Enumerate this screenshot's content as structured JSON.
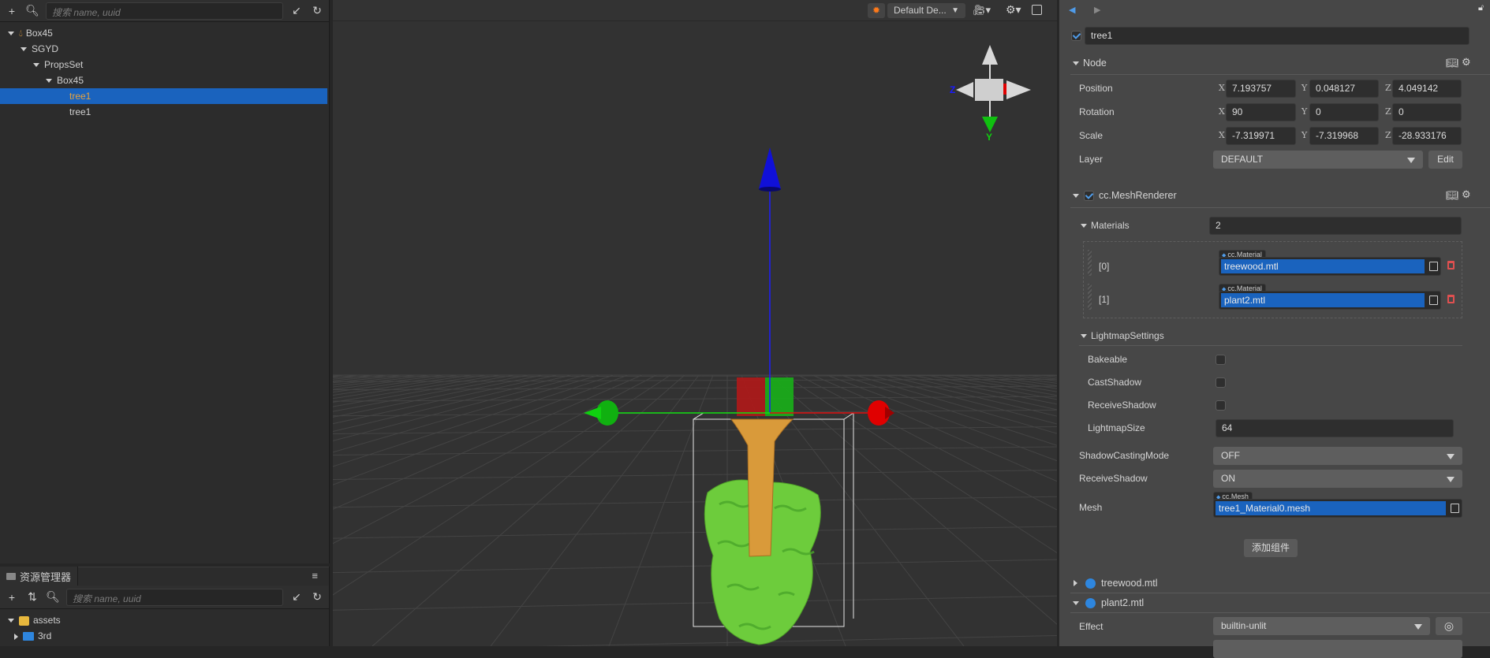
{
  "hierarchy": {
    "search_placeholder": "搜索 name, uuid",
    "items": [
      {
        "label": "Box45",
        "depth": 0,
        "expanded": true,
        "icon": "prefab-drop-icon"
      },
      {
        "label": "SGYD",
        "depth": 1,
        "expanded": true
      },
      {
        "label": "PropsSet",
        "depth": 2,
        "expanded": true
      },
      {
        "label": "Box45",
        "depth": 3,
        "expanded": true
      },
      {
        "label": "tree1",
        "depth": 4,
        "selected": true
      },
      {
        "label": "tree1",
        "depth": 4
      }
    ]
  },
  "assets": {
    "tab_label": "资源管理器",
    "search_placeholder": "搜索 name, uuid",
    "items": [
      {
        "label": "assets",
        "expanded": true,
        "icon": "database-icon"
      },
      {
        "label": "3rd",
        "expanded": false,
        "icon": "folder-icon"
      }
    ]
  },
  "scene": {
    "camera_dropdown": "Default De...",
    "gizmo_labels": {
      "z": "Z",
      "y": "Y"
    }
  },
  "inspector": {
    "node_name": "tree1",
    "node_active": true,
    "node_section": "Node",
    "position": {
      "label": "Position",
      "x": "7.193757",
      "y": "0.048127",
      "z": "4.049142"
    },
    "rotation": {
      "label": "Rotation",
      "x": "90",
      "y": "0",
      "z": "0"
    },
    "scale": {
      "label": "Scale",
      "x": "-7.319971",
      "y": "-7.319968",
      "z": "-28.933176"
    },
    "axis": {
      "x": "X",
      "y": "Y",
      "z": "Z"
    },
    "layer": {
      "label": "Layer",
      "value": "DEFAULT",
      "edit": "Edit"
    },
    "mesh_renderer": {
      "title": "cc.MeshRenderer",
      "enabled": true,
      "materials_label": "Materials",
      "materials_count": "2",
      "materials": [
        {
          "index": "[0]",
          "type": "cc.Material",
          "value": "treewood.mtl"
        },
        {
          "index": "[1]",
          "type": "cc.Material",
          "value": "plant2.mtl"
        }
      ],
      "lightmap": {
        "title": "LightmapSettings",
        "bakeable": "Bakeable",
        "cast_shadow": "CastShadow",
        "receive_shadow": "ReceiveShadow",
        "lightmap_size_label": "LightmapSize",
        "lightmap_size": "64"
      },
      "shadow_casting_mode": {
        "label": "ShadowCastingMode",
        "value": "OFF"
      },
      "receive_shadow": {
        "label": "ReceiveShadow",
        "value": "ON"
      },
      "mesh": {
        "label": "Mesh",
        "type": "cc.Mesh",
        "value": "tree1_Material0.mesh"
      }
    },
    "add_component": "添加组件",
    "material_sections": [
      {
        "name": "treewood.mtl",
        "expanded": false
      },
      {
        "name": "plant2.mtl",
        "expanded": true
      }
    ],
    "effect": {
      "label": "Effect",
      "value": "builtin-unlit"
    }
  },
  "colors": {
    "selection": "#1a63be",
    "accent_orange": "#e8a33d",
    "x_axis": "#e00000",
    "y_axis": "#00c000",
    "z_axis": "#0000e0"
  }
}
